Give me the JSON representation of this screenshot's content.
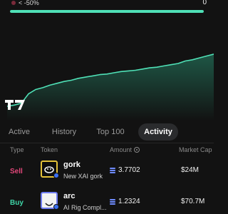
{
  "filter": {
    "label": "< -50%",
    "value": "0",
    "progress": 1.0,
    "dot_color": "#7a2a3a",
    "bar_color": "#4fe0b6"
  },
  "chart_data": {
    "type": "area",
    "color": "#4fe0b6",
    "x": [
      0,
      1,
      2,
      3,
      4,
      5,
      6,
      7,
      8,
      9,
      10,
      11,
      12,
      13,
      14,
      15,
      16,
      17,
      18,
      19,
      20,
      21,
      22,
      23,
      24,
      25,
      26,
      27,
      28,
      29
    ],
    "values": [
      0.0,
      0.02,
      0.05,
      0.2,
      0.27,
      0.3,
      0.34,
      0.37,
      0.4,
      0.42,
      0.45,
      0.47,
      0.49,
      0.51,
      0.52,
      0.54,
      0.56,
      0.57,
      0.58,
      0.6,
      0.62,
      0.63,
      0.65,
      0.67,
      0.69,
      0.73,
      0.75,
      0.78,
      0.81,
      0.84
    ],
    "ylim": [
      0,
      1
    ],
    "grid": false,
    "title": "",
    "xlabel": "",
    "ylabel": ""
  },
  "tabs": [
    {
      "label": "Active",
      "active": false
    },
    {
      "label": "History",
      "active": false
    },
    {
      "label": "Top 100",
      "active": false
    },
    {
      "label": "Activity",
      "active": true
    }
  ],
  "table": {
    "headers": {
      "type": "Type",
      "token": "Token",
      "amount": "Amount",
      "mcap": "Market Cap"
    },
    "rows": [
      {
        "type": "Sell",
        "side": "sell",
        "name": "gork",
        "subtitle": "New XAI gork",
        "amount": "3.7702",
        "mcap": "$24M",
        "icon": "gork-token-icon"
      },
      {
        "type": "Buy",
        "side": "buy",
        "name": "arc",
        "subtitle": "AI Rig Compl...",
        "amount": "1.2324",
        "mcap": "$70.7M",
        "icon": "arc-token-icon"
      }
    ]
  },
  "colors": {
    "background": "#121212",
    "sell": "#e3477a",
    "buy": "#3fd6a8",
    "accent": "#4fe0b6",
    "amount_icon": "#6e8bff"
  }
}
